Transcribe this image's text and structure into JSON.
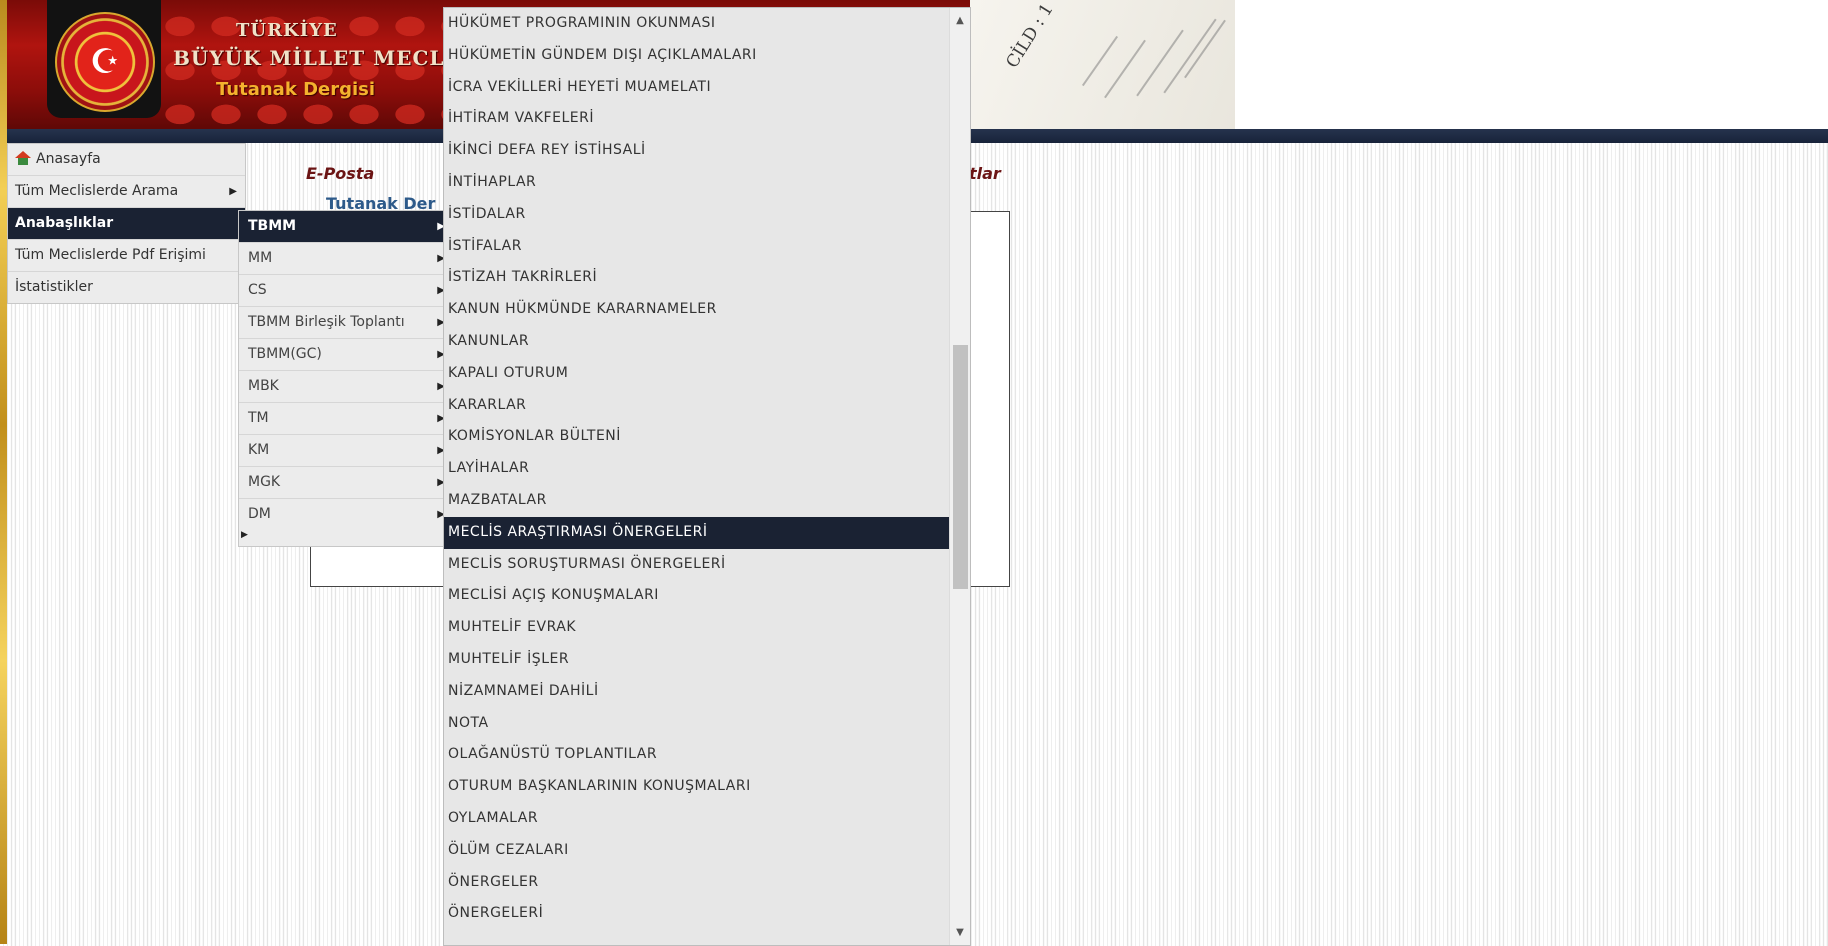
{
  "header": {
    "title_line1": "TÜRKİYE",
    "title_line2": "BÜYÜK MİLLET MECLİSİ",
    "subtitle": "Tutanak Dergisi",
    "document_text": "CİLD : 1"
  },
  "left_menu": {
    "items": [
      {
        "label": "Anasayfa",
        "icon": "home-icon"
      },
      {
        "label": "Tüm Meclislerde Arama",
        "has_submenu": true
      },
      {
        "label": "Anabaşlıklar",
        "has_submenu": true,
        "active": true
      },
      {
        "label": "Tüm Meclislerde Pdf Erişimi"
      },
      {
        "label": "İstatistikler"
      }
    ]
  },
  "page": {
    "eposta": "E-Posta",
    "kotlar_partial": "otlar",
    "tutanak_partial": "Tutanak Der"
  },
  "submenu": {
    "items": [
      "TBMM",
      "MM",
      "CS",
      "TBMM Birleşik Toplantı",
      "TBMM(GC)",
      "MBK",
      "TM",
      "KM",
      "MGK",
      "DM"
    ],
    "active_index": 0
  },
  "topic_menu": {
    "items": [
      "HÜKÜMET PROGRAMININ OKUNMASI",
      "HÜKÜMETİN GÜNDEM DIŞI AÇIKLAMALARI",
      "İCRA VEKİLLERİ HEYETİ MUAMELATI",
      "İHTİRAM VAKFELERİ",
      "İKİNCİ DEFA REY İSTİHSALİ",
      "İNTİHAPLAR",
      "İSTİDALAR",
      "İSTİFALAR",
      "İSTİZAH TAKRİRLERİ",
      "KANUN HÜKMÜNDE KARARNAMELER",
      "KANUNLAR",
      "KAPALI OTURUM",
      "KARARLAR",
      "KOMİSYONLAR BÜLTENİ",
      "LAYİHALAR",
      "MAZBATALAR",
      "MECLİS ARAŞTIRMASI ÖNERGELERİ",
      "MECLİS SORUŞTURMASI ÖNERGELERİ",
      "MECLİSİ AÇIŞ KONUŞMALARI",
      "MUHTELİF EVRAK",
      "MUHTELİF İŞLER",
      "NİZAMNAMEİ DAHİLİ",
      "NOTA",
      "OLAĞANÜSTÜ TOPLANTILAR",
      "OTURUM BAŞKANLARININ KONUŞMALARI",
      "OYLAMALAR",
      "ÖLÜM CEZALARI",
      "ÖNERGELER",
      "ÖNERGELERİ"
    ],
    "active_index": 16
  },
  "colors": {
    "active_bg": "#1a2233",
    "menu_bg": "#ececec",
    "banner_red": "#b0140f",
    "gold": "#f4b22e"
  }
}
